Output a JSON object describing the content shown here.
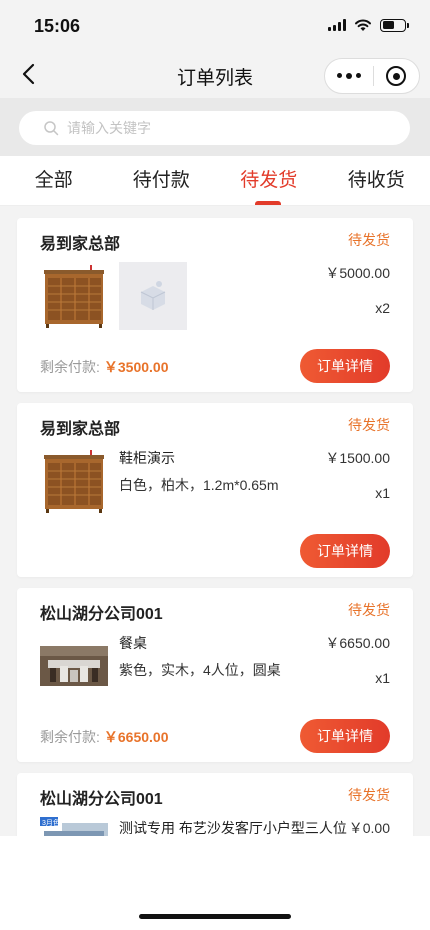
{
  "status_bar": {
    "time": "15:06"
  },
  "nav": {
    "title": "订单列表"
  },
  "search": {
    "placeholder": "请输入关键字"
  },
  "tabs": [
    {
      "label": "全部",
      "active": false
    },
    {
      "label": "待付款",
      "active": false
    },
    {
      "label": "待发货",
      "active": true
    },
    {
      "label": "待收货",
      "active": false
    }
  ],
  "orders": [
    {
      "shop": "易到家总部",
      "status": "待发货",
      "goods_name": "",
      "goods_spec": "",
      "price": "￥5000.00",
      "qty": "x2",
      "remain_label": "剩余付款:",
      "remain_amount": "￥3500.00",
      "button": "订单详情"
    },
    {
      "shop": "易到家总部",
      "status": "待发货",
      "goods_name": "鞋柜演示",
      "goods_spec": "白色，柏木，1.2m*0.65m",
      "price": "￥1500.00",
      "qty": "x1",
      "button": "订单详情"
    },
    {
      "shop": "松山湖分公司001",
      "status": "待发货",
      "goods_name": "餐桌",
      "goods_spec": "紫色，实木，4人位，圆桌",
      "price": "￥6650.00",
      "qty": "x1",
      "remain_label": "剩余付款:",
      "remain_amount": "￥6650.00",
      "button": "订单详情"
    },
    {
      "shop": "松山湖分公司001",
      "status": "待发货",
      "goods_name": "测试专用 布艺沙发客厅小户型三人位",
      "price": "￥0.00",
      "thumb_tag": "3月色"
    }
  ],
  "colors": {
    "accent": "#e23b2a",
    "status": "#e8732a",
    "background": "#f3f3f3"
  },
  "icons": [
    "back-arrow-icon",
    "more-dots-icon",
    "close-target-icon",
    "search-icon",
    "signal-icon",
    "wifi-icon",
    "battery-icon"
  ]
}
